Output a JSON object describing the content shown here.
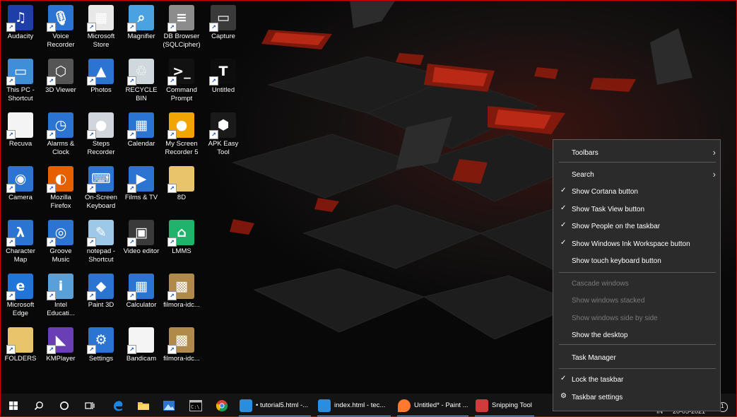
{
  "desktop_icons": [
    {
      "name": "audacity-icon",
      "label": "Audacity",
      "bg": "#1e3ea8",
      "ch": "♫"
    },
    {
      "name": "voice-recorder-icon",
      "label": "Voice\nRecorder",
      "bg": "#2b74d1",
      "ch": "🎙"
    },
    {
      "name": "microsoft-store-icon",
      "label": "Microsoft\nStore",
      "bg": "#e8e8e8",
      "ch": "▦"
    },
    {
      "name": "magnifier-icon",
      "label": "Magnifier",
      "bg": "#4aa3e0",
      "ch": "⌕"
    },
    {
      "name": "db-browser-icon",
      "label": "DB Browser\n(SQLCipher)",
      "bg": "#8c8c8c",
      "ch": "≡"
    },
    {
      "name": "capture-icon",
      "label": "Capture",
      "bg": "#3a3a3a",
      "ch": "▭"
    },
    {
      "name": "this-pc-icon",
      "label": "This PC -\nShortcut",
      "bg": "#3e8fd8",
      "ch": "▭"
    },
    {
      "name": "3d-viewer-icon",
      "label": "3D Viewer",
      "bg": "#555555",
      "ch": "⬡"
    },
    {
      "name": "photos-icon",
      "label": "Photos",
      "bg": "#2b74d1",
      "ch": "▲"
    },
    {
      "name": "recycle-bin-icon",
      "label": "RECYCLE\nBIN",
      "bg": "#cfd8dc",
      "ch": "♲"
    },
    {
      "name": "command-prompt-icon",
      "label": "Command\nPrompt",
      "bg": "#111111",
      "ch": ">_"
    },
    {
      "name": "untitled-icon",
      "label": "Untitled",
      "bg": "#0d0d0d",
      "ch": "T"
    },
    {
      "name": "recuva-icon",
      "label": "Recuva",
      "bg": "#f4f4f4",
      "ch": ""
    },
    {
      "name": "alarms-clock-icon",
      "label": "Alarms &\nClock",
      "bg": "#2b74d1",
      "ch": "◷"
    },
    {
      "name": "steps-recorder-icon",
      "label": "Steps\nRecorder",
      "bg": "#d0d6dc",
      "ch": "●"
    },
    {
      "name": "calendar-icon",
      "label": "Calendar",
      "bg": "#2b74d1",
      "ch": "▦"
    },
    {
      "name": "my-screen-recorder-icon",
      "label": "My Screen\nRecorder 5",
      "bg": "#f0a500",
      "ch": "●"
    },
    {
      "name": "apk-easy-tool-icon",
      "label": "APK Easy\nTool",
      "bg": "#1a1a1a",
      "ch": "⬢"
    },
    {
      "name": "camera-icon",
      "label": "Camera",
      "bg": "#2b74d1",
      "ch": "◉"
    },
    {
      "name": "mozilla-firefox-icon",
      "label": "Mozilla\nFirefox",
      "bg": "#e66000",
      "ch": "◐"
    },
    {
      "name": "on-screen-keyboard-icon",
      "label": "On-Screen\nKeyboard",
      "bg": "#2b74d1",
      "ch": "⌨"
    },
    {
      "name": "films-tv-icon",
      "label": "Films & TV",
      "bg": "#2b74d1",
      "ch": "▶"
    },
    {
      "name": "folder-8d-icon",
      "label": "8D",
      "bg": "#e9c46a",
      "ch": ""
    },
    {
      "name": "empty-slot",
      "label": "",
      "bg": "transparent",
      "ch": ""
    },
    {
      "name": "character-map-icon",
      "label": "Character\nMap",
      "bg": "#2b74d1",
      "ch": "λ"
    },
    {
      "name": "groove-music-icon",
      "label": "Groove\nMusic",
      "bg": "#2b74d1",
      "ch": "◎"
    },
    {
      "name": "notepad-icon",
      "label": "notepad -\nShortcut",
      "bg": "#9ec8e8",
      "ch": "✎"
    },
    {
      "name": "video-editor-icon",
      "label": "Video editor",
      "bg": "#3a3a3a",
      "ch": "▣"
    },
    {
      "name": "lmms-icon",
      "label": "LMMS",
      "bg": "#1fb36b",
      "ch": "⌂"
    },
    {
      "name": "empty-slot-2",
      "label": "",
      "bg": "transparent",
      "ch": ""
    },
    {
      "name": "microsoft-edge-icon",
      "label": "Microsoft\nEdge",
      "bg": "#1f75d8",
      "ch": "e"
    },
    {
      "name": "intel-education-icon",
      "label": "Intel\nEducati...",
      "bg": "#5aa0d8",
      "ch": "i"
    },
    {
      "name": "paint-3d-icon",
      "label": "Paint 3D",
      "bg": "#2b74d1",
      "ch": "◆"
    },
    {
      "name": "calculator-icon",
      "label": "Calculator",
      "bg": "#2b74d1",
      "ch": "▦"
    },
    {
      "name": "filmora-installer-icon",
      "label": "filmora-idc...",
      "bg": "#b08a4a",
      "ch": "▩"
    },
    {
      "name": "empty-slot-3",
      "label": "",
      "bg": "transparent",
      "ch": ""
    },
    {
      "name": "folders-icon",
      "label": "FOLDERS",
      "bg": "#e9c46a",
      "ch": ""
    },
    {
      "name": "kmplayer-icon",
      "label": "KMPlayer",
      "bg": "#6a3fb5",
      "ch": "◣"
    },
    {
      "name": "settings-icon",
      "label": "Settings",
      "bg": "#2b74d1",
      "ch": "⚙"
    },
    {
      "name": "bandicam-icon",
      "label": "Bandicam",
      "bg": "#f4f4f4",
      "ch": ""
    },
    {
      "name": "filmora-installer-2-icon",
      "label": "filmora-idc...",
      "bg": "#b08a4a",
      "ch": "▩"
    },
    {
      "name": "empty-slot-4",
      "label": "",
      "bg": "transparent",
      "ch": ""
    }
  ],
  "context_menu": {
    "items": [
      {
        "name": "menu-toolbars",
        "label": "Toolbars",
        "check": "",
        "submenu": true,
        "disabled": false
      },
      {
        "name": "menu-search",
        "label": "Search",
        "check": "",
        "submenu": true,
        "disabled": false
      },
      {
        "name": "menu-show-cortana",
        "label": "Show Cortana button",
        "check": "✓",
        "submenu": false,
        "disabled": false
      },
      {
        "name": "menu-show-task-view",
        "label": "Show Task View button",
        "check": "✓",
        "submenu": false,
        "disabled": false
      },
      {
        "name": "menu-show-people",
        "label": "Show People on the taskbar",
        "check": "✓",
        "submenu": false,
        "disabled": false
      },
      {
        "name": "menu-show-ink-workspace",
        "label": "Show Windows Ink Workspace button",
        "check": "✓",
        "submenu": false,
        "disabled": false
      },
      {
        "name": "menu-show-touch-keyboard",
        "label": "Show touch keyboard button",
        "check": "",
        "submenu": false,
        "disabled": false
      },
      {
        "name": "menu-cascade-windows",
        "label": "Cascade windows",
        "check": "",
        "submenu": false,
        "disabled": true
      },
      {
        "name": "menu-windows-stacked",
        "label": "Show windows stacked",
        "check": "",
        "submenu": false,
        "disabled": true
      },
      {
        "name": "menu-windows-side-by-side",
        "label": "Show windows side by side",
        "check": "",
        "submenu": false,
        "disabled": true
      },
      {
        "name": "menu-show-desktop",
        "label": "Show the desktop",
        "check": "",
        "submenu": false,
        "disabled": false
      },
      {
        "name": "menu-task-manager",
        "label": "Task Manager",
        "check": "",
        "submenu": false,
        "disabled": false
      },
      {
        "name": "menu-lock-taskbar",
        "label": "Lock the taskbar",
        "check": "✓",
        "submenu": false,
        "disabled": false
      },
      {
        "name": "menu-taskbar-settings",
        "label": "Taskbar settings",
        "check": "⚙",
        "submenu": false,
        "disabled": false
      }
    ]
  },
  "taskbar": {
    "apps": [
      {
        "name": "taskbar-vscode-tutorial5",
        "label": "• tutorial5.html -...",
        "color": "#2a8ee0",
        "active": true
      },
      {
        "name": "taskbar-vscode-index",
        "label": "index.html - tec...",
        "color": "#2a8ee0",
        "active": true
      },
      {
        "name": "taskbar-paint-untitled",
        "label": "Untitled* - Paint ...",
        "color": "#ff7a2e",
        "active": true
      },
      {
        "name": "taskbar-snipping-tool",
        "label": "Snipping Tool",
        "color": "#d23b3b",
        "active": true
      }
    ],
    "tray_lang": "IN",
    "tray_date": "20-05-2021",
    "notification_count": "1"
  }
}
